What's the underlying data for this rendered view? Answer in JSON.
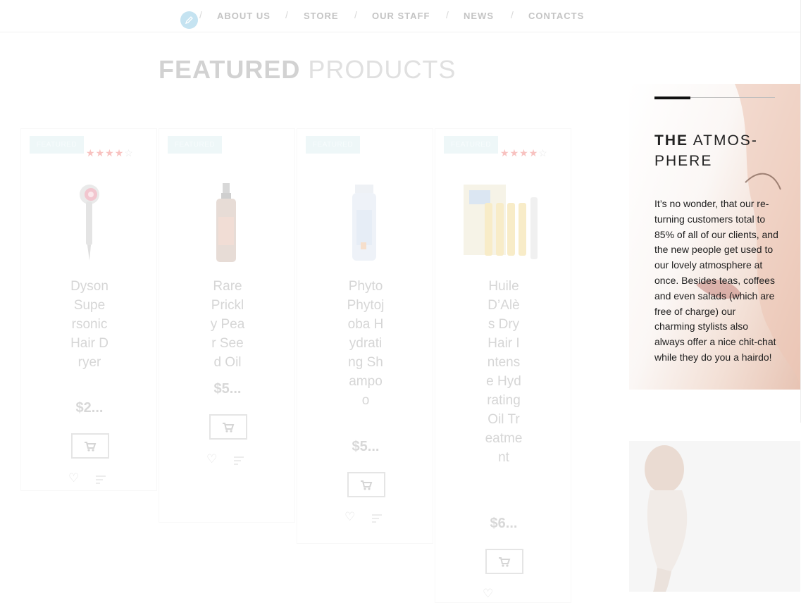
{
  "nav": {
    "items": [
      "ABOUT US",
      "STORE",
      "OUR STAFF",
      "NEWS",
      "CONTACTS"
    ],
    "separator": "/"
  },
  "section": {
    "title_bold": "FEATURED",
    "title_light": "PRODUCTS"
  },
  "products": [
    {
      "badge": "FEATURED",
      "name": "Dyson Su­per­sonic Hair Dryer",
      "price": "$2...",
      "rating": 4,
      "icon": "hair-dryer"
    },
    {
      "badge": "FEATURED",
      "name": "Rare Prickly Pear Seed Oil",
      "price": "$5...",
      "rating": null,
      "icon": "spray-bottle"
    },
    {
      "badge": "FEATURED",
      "name": "Phyto Phy­tojoba Hy­drat­ing Sham­poo",
      "price": "$5...",
      "rating": null,
      "icon": "shampoo-bottle"
    },
    {
      "badge": "FEATURED",
      "name": "Huile D’Alès Dry Hair In­tense Hy­drat­ing Oil Treat­ment",
      "price": "$6...",
      "rating": 4,
      "icon": "ampoule-set"
    }
  ],
  "atmosphere": {
    "title_bold": "THE",
    "title_light": "ATMOS­PHERE",
    "text": "It’s no wonder, that our re­turning customers total to 85% of all of our clients, and the new people get used to our lovely atmos­phere at once. Besides teas, coffees and even salads (which are free of charge) our charming stylists also always offer a nice chit-chat while they do you a hairdo!"
  },
  "colors": {
    "badge_bg": "#eef7f8",
    "star": "#f8c2c0",
    "dark_bar": "#111111"
  }
}
